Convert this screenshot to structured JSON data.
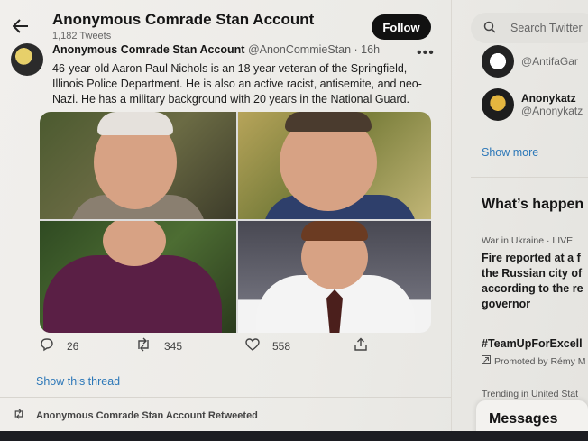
{
  "header": {
    "title": "Anonymous Comrade Stan Account",
    "tweet_count": "1,182 Tweets",
    "follow_label": "Follow"
  },
  "tweet": {
    "author": "Anonymous Comrade Stan Account",
    "handle": "@AnonCommieStan · 16h",
    "text": "46-year-old Aaron Paul Nichols is an 18 year veteran of the Springfield, Illinois Police Department. He is also an active racist, antisemite, and neo-Nazi. He has a military background with 20 years in the National Guard.",
    "replies": "26",
    "retweets": "345",
    "likes": "558"
  },
  "thread": {
    "show_thread": "Show this thread",
    "retweeted_label": "Anonymous Comrade Stan Account Retweeted"
  },
  "sidebar": {
    "search_placeholder": "Search Twitter",
    "accounts": [
      {
        "name": "",
        "handle": "@AntifaGar"
      },
      {
        "name": "Anonykatz",
        "handle": "@Anonykatz"
      }
    ],
    "show_more": "Show more",
    "whats_happening": "What’s happen",
    "trend": {
      "category": "War in Ukraine · LIVE",
      "title_lines": [
        "Fire reported at a f",
        "the Russian city of",
        "according to the re",
        "governor"
      ]
    },
    "hashtag": "#TeamUpForExcell",
    "promoted": "Promoted by Rémy M",
    "trending_location": "Trending in United Stat",
    "messages": "Messages"
  },
  "colors": {
    "link": "#2d78b8",
    "follow_bg": "#111111"
  }
}
